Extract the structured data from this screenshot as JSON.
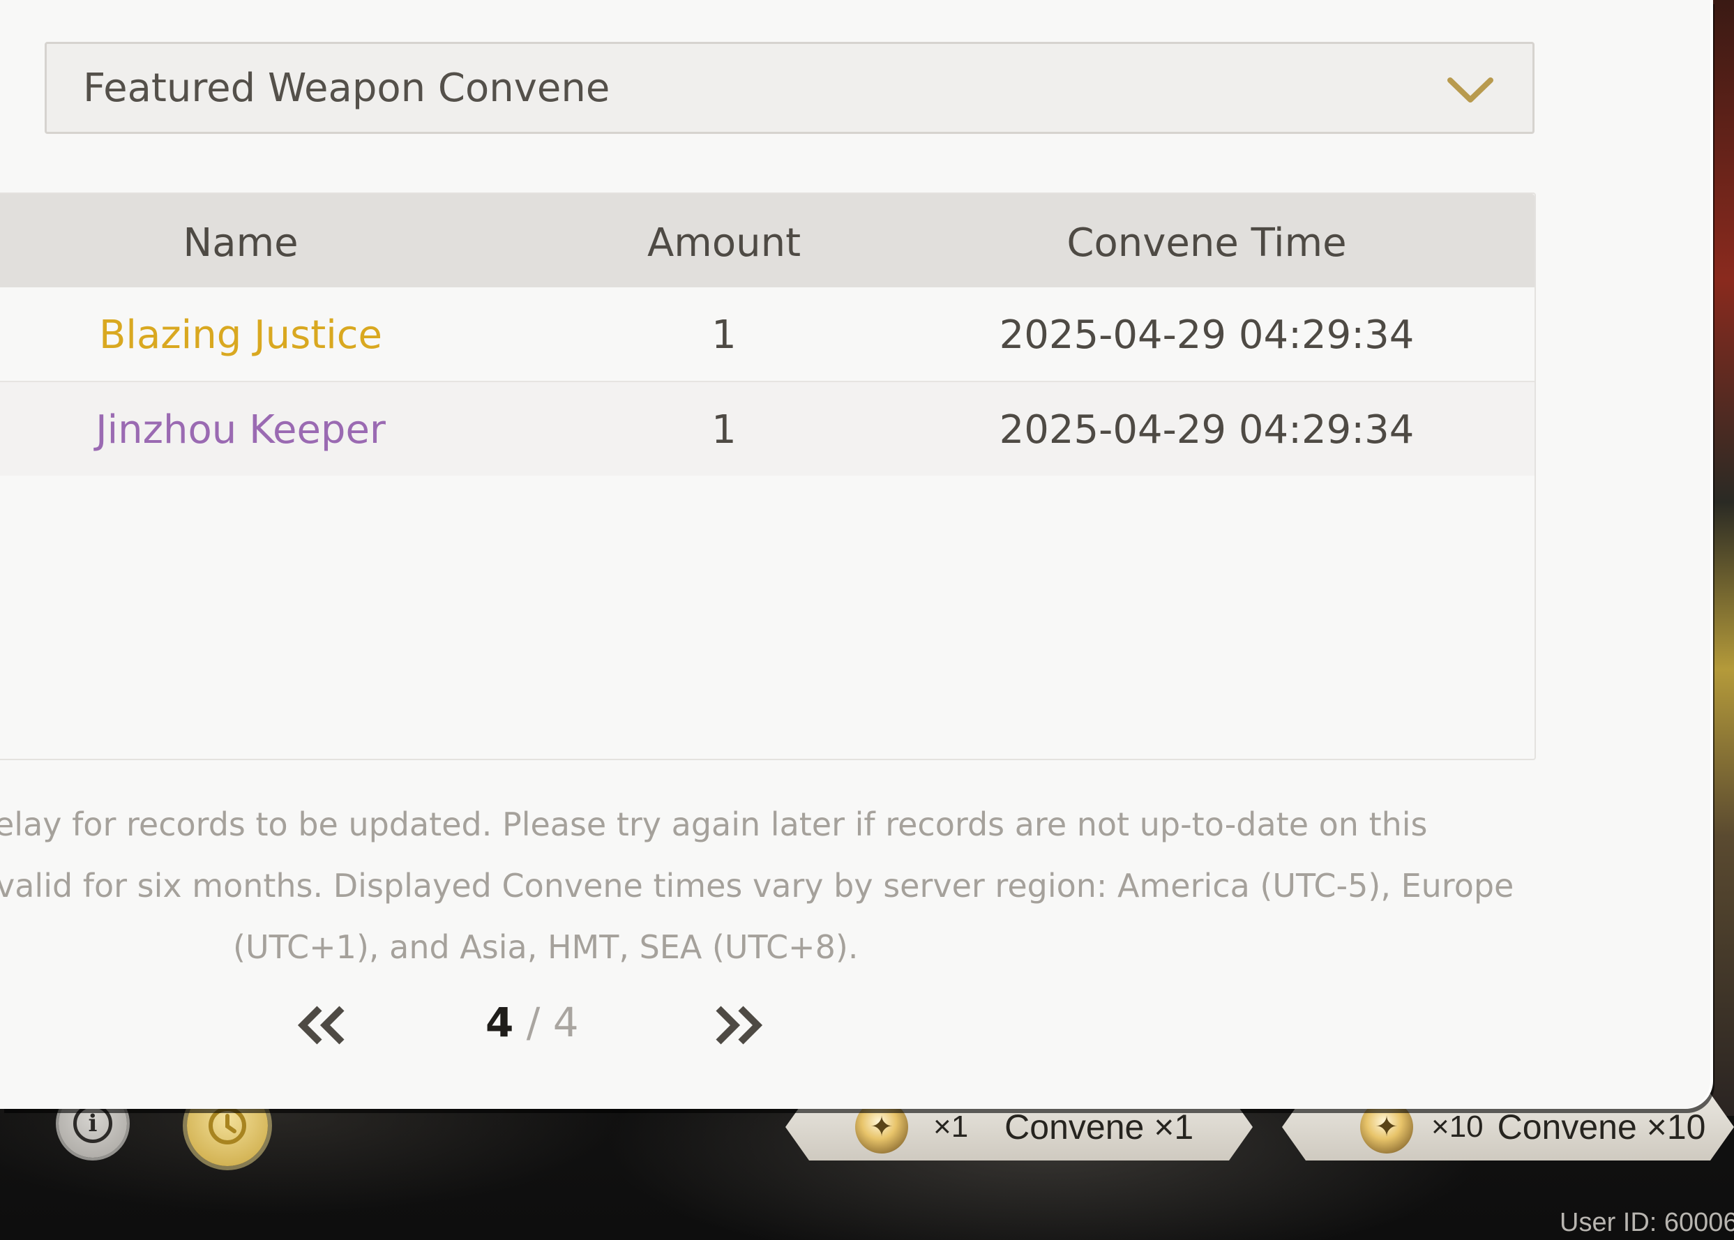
{
  "window": {
    "user_id_label": "User ID: 60006"
  },
  "selector": {
    "value": "Featured Weapon Convene",
    "chevron_icon": "chevron-down-icon",
    "chevron_color": "#b89a4e"
  },
  "table": {
    "headers": [
      "Name",
      "Amount",
      "Convene Time"
    ],
    "rows": [
      {
        "name": "Blazing Justice",
        "amount": "1",
        "time": "2025-04-29 04:29:34",
        "color": "#d9a820"
      },
      {
        "name": "Jinzhou Keeper",
        "amount": "1",
        "time": "2025-04-29 04:29:34",
        "color": "#9a6ab2"
      }
    ]
  },
  "notice": {
    "line1": "elay for records to be updated. Please try again later if records are not up-to-date on this",
    "line2": "valid for six months. Displayed Convene times vary by server region: America (UTC-5), Europe",
    "line3": "(UTC+1), and Asia, HMT, SEA (UTC+8)."
  },
  "pagination": {
    "current": "4",
    "separator": " / ",
    "total": "4",
    "prev_icon": "double-chevron-left-icon",
    "next_icon": "double-chevron-right-icon"
  },
  "bottom_bar": {
    "info_icon": "info-icon",
    "history_icon": "history-icon",
    "convene_one": {
      "cost": "×1",
      "label": "Convene ×1",
      "icon": "radiant-tide-coin-icon"
    },
    "convene_ten": {
      "cost": "×10",
      "label": "Convene ×10",
      "icon": "radiant-tide-coin-icon"
    }
  }
}
